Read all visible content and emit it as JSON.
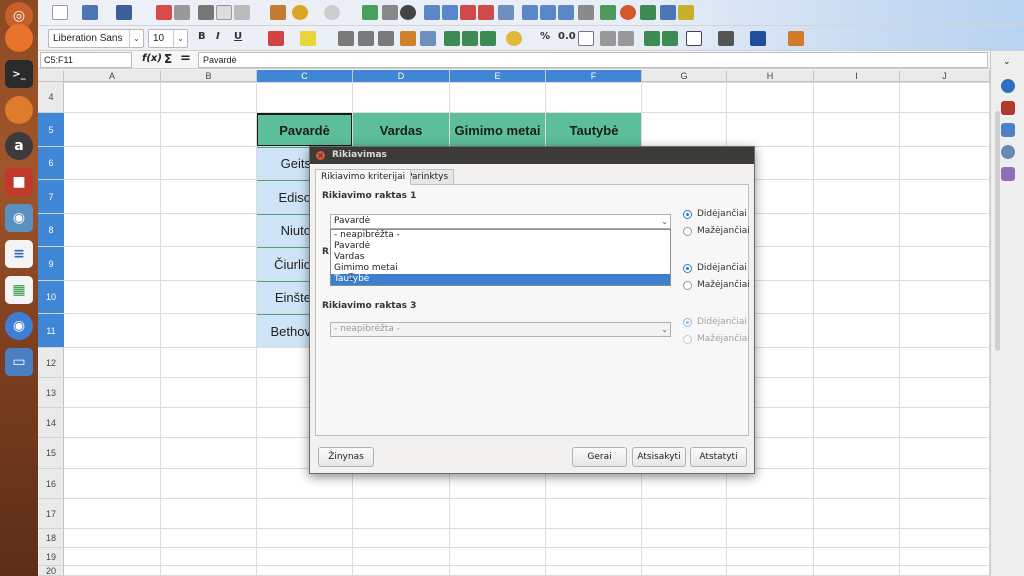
{
  "launcher": {
    "icons": [
      "dash-icon",
      "firefox-icon",
      "terminal-icon",
      "firefox-icon",
      "amazon-icon",
      "video-icon",
      "screenshot-icon",
      "writer-icon",
      "calc-icon",
      "chromium-icon",
      "desktop-icon"
    ]
  },
  "toolbar": {
    "font_name": "Liberation Sans",
    "font_size": "10",
    "bold_label": "B",
    "italic_label": "I",
    "underline_label": "U",
    "number_format_label": "0.0",
    "percent_label": "%"
  },
  "formula_bar": {
    "name_box": "C5:F11",
    "content": "Pavardė"
  },
  "columns": [
    "A",
    "B",
    "C",
    "D",
    "E",
    "F",
    "G",
    "H",
    "I",
    "J"
  ],
  "rows": [
    "4",
    "5",
    "6",
    "7",
    "8",
    "9",
    "10",
    "11",
    "12",
    "13",
    "14",
    "15",
    "16",
    "17",
    "18",
    "19",
    "20"
  ],
  "sheet": {
    "headers": [
      "Pavardė",
      "Vardas",
      "Gimimo metai",
      "Tautybė"
    ],
    "col_c_values": [
      "Geits",
      "Ediso",
      "Niuto",
      "Čiurlio",
      "Einšte",
      "Bethov"
    ]
  },
  "dialog": {
    "title": "Rikiavimas",
    "tabs": [
      "Rikiavimo kriterijai",
      "Parinktys"
    ],
    "key1_label": "Rikiavimo raktas 1",
    "key1_value": "Pavardė",
    "key1_options": [
      "- neapibrėžta -",
      "Pavardė",
      "Vardas",
      "Gimimo metai",
      "Tautybė"
    ],
    "key1_highlighted": "Tautybė",
    "key2_partial_label": "R",
    "key3_label": "Rikiavimo raktas 3",
    "key3_value": "- neapibrėžta -",
    "ascending": "Didėjančiai",
    "descending": "Mažėjančiai",
    "buttons": {
      "help": "Žinynas",
      "ok": "Gerai",
      "cancel": "Atsisakyti",
      "reset": "Atstatyti"
    }
  },
  "colors": {
    "header_fill": "#5cbf9a",
    "data_fill": "#cfe5f7",
    "selection": "#3f86d4",
    "dialog_title_bar": "#3c3b37"
  }
}
